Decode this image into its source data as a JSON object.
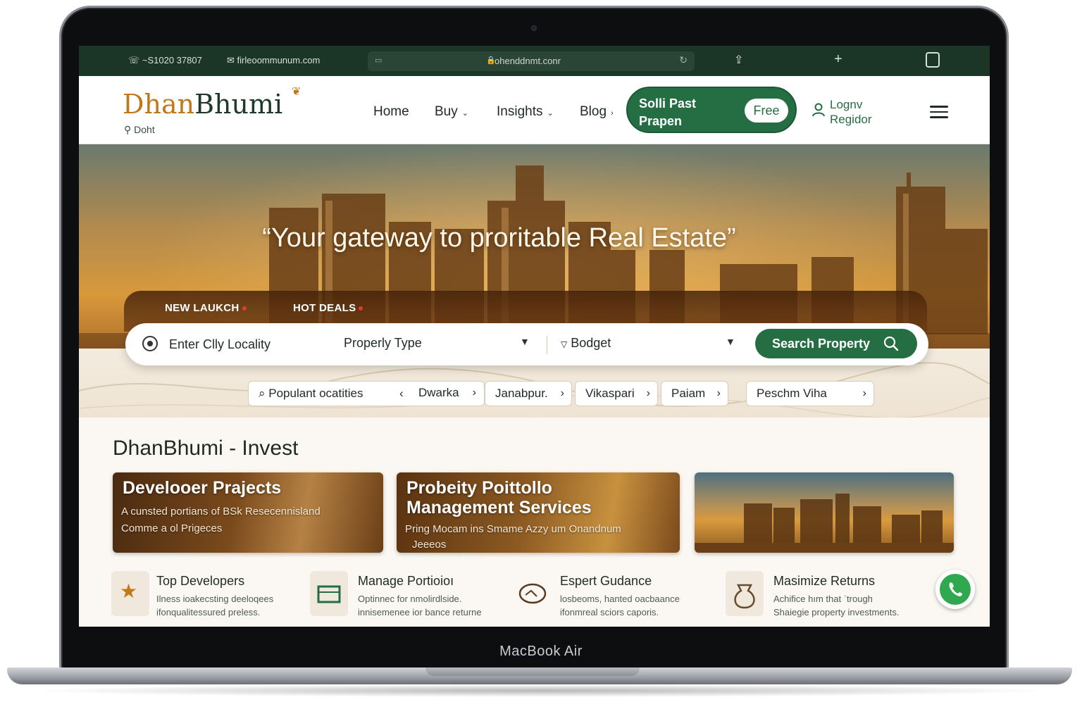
{
  "device": {
    "label": "MacBook Air"
  },
  "browser": {
    "phone": "~S1020 37807",
    "email": "firleoommunum.com",
    "url": "ohenddnmt.conr"
  },
  "header": {
    "logo_part1": "Dhan",
    "logo_part2": "Bhumi",
    "location": "Doht",
    "nav": {
      "home": "Home",
      "buy": "Buy",
      "insights": "Insights",
      "blog": "Blog"
    },
    "post_cta": {
      "label": "Solli Past Prapen",
      "badge": "Free"
    },
    "login_label": "Lognv Regidor"
  },
  "hero": {
    "title": "“Your gateway to proritable Real Estate”",
    "tabs": [
      "NEW LAUKCH",
      "HOT DEALS"
    ],
    "search": {
      "location_placeholder": "Enter Clly Locality",
      "property_type": "Properly Type",
      "budget": "Bodget",
      "button_label": "Search Property"
    },
    "localities": {
      "lead": "Populant ocatities",
      "items": [
        "Dwarka",
        "Janabpur.",
        "Vikaspari",
        "Paiam",
        "Peschm Viha"
      ]
    }
  },
  "invest": {
    "title": "DhanBhumi - Invest",
    "cards": [
      {
        "title": "Develooer Prajects",
        "desc_line1": "A cunsted portians of BSk Resecennisland",
        "desc_line2": "Comme a ol Prigeces"
      },
      {
        "title_line1": "Probeity Poittollo",
        "title_line2": "Management Services",
        "desc_line1": "Pring Mocam ins Smame Azzy um Onandnum",
        "desc_line2": "Jeeeos"
      }
    ],
    "features": [
      {
        "title": "Top Developers",
        "desc_line1": "Ilness ioakecsting deeloqees",
        "desc_line2": "ifonqualitessured preless.",
        "icon": "star-icon"
      },
      {
        "title": "Manage Portioioı",
        "desc_line1": "Optinnec for nmolirdlside.",
        "desc_line2": "innisemenee ior bance returne",
        "icon": "portfolio-icon"
      },
      {
        "title": "Espert Gudance",
        "desc_line1": "losbeoms, hanted oacbaance",
        "desc_line2": "ifonmreal sciors caporis.",
        "icon": "handshake-icon"
      },
      {
        "title": "Masimize Returns",
        "desc_line1": "Achifice hım that ˈtrough",
        "desc_line2": "Shaiegie property investments.",
        "icon": "money-bag-icon"
      }
    ]
  },
  "colors": {
    "brand_green": "#256e44",
    "brand_gold": "#c1781b",
    "browser_bar": "#1b3527"
  }
}
